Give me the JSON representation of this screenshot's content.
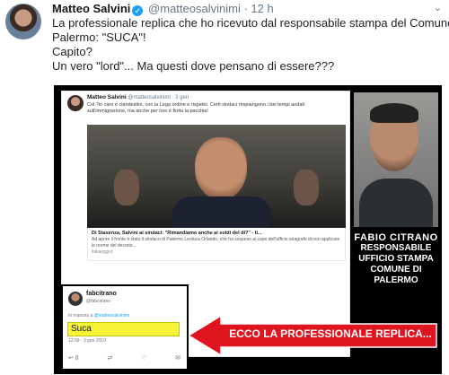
{
  "tweet": {
    "name": "Matteo Salvini",
    "handle": "@matteosalvinimi",
    "separator": "·",
    "time": "12 h",
    "lines": [
      "La professionale replica che ho ricevuto dal responsabile stampa del Comune di",
      "Palermo: \"SUCA\"!",
      "Capito?",
      "Un vero \"lord\"... Ma questi dove pensano di essere???"
    ]
  },
  "embedded_tweet": {
    "name": "Matteo Salvini",
    "handle": "@matteosalvinimi · 3 gen",
    "text": "Col ?io caro e clandestini, con la Lega ordine e rispetto. Certi sindaci rimpiangono i bei tempi andati sull'immigrazione, ma anche per loro è finita la pacchia!",
    "link_title": "Di Stasenza, Salvini ai sindaci: \"Rimandiamo anche ai soldi del dl?\" - Il...",
    "link_desc": "Ad aprire il fronte è stato il sindaco di Palermo Leoluca Orlando, che ha sospeso ai capo dell'ufficio anagrafe di non applicare le norme del decreto...",
    "link_source": "italiaoggi.it"
  },
  "caption": {
    "name": "FABIO CITRANO",
    "lines": [
      "RESPONSABILE",
      "UFFICIO STAMPA",
      "COMUNE DI PALERMO"
    ]
  },
  "reply": {
    "name": "fabcitrano",
    "handle": "@fabcitrano",
    "reply_prefix": "In risposta a",
    "reply_to": "@matteosalvinimi",
    "text": "Suca",
    "time": "12:09 - 3 gen 2019",
    "actions": [
      "↩ 8",
      "⇄",
      "♡",
      "✉"
    ]
  },
  "arrow_label": "ECCO LA PROFESSIONALE REPLICA...",
  "icons": {
    "verified": "verified-badge-icon",
    "caret": "chevron-down-icon"
  },
  "colors": {
    "twitter_blue": "#1da1f2",
    "arrow_red": "#e0141e",
    "highlight_yellow": "#f7f336"
  }
}
